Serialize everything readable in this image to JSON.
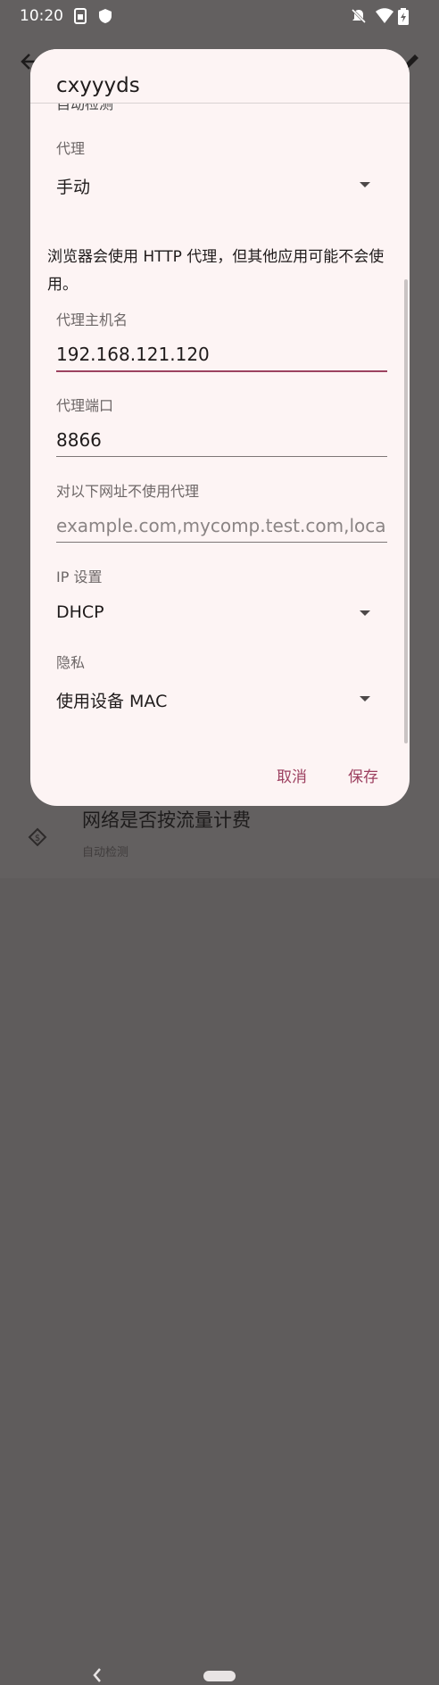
{
  "status_bar": {
    "time": "10:20",
    "icons": [
      "sim-icon",
      "shield-icon",
      "notifications-off-icon",
      "wifi-icon",
      "battery-icon"
    ]
  },
  "background": {
    "row_title": "网络是否按流量计费",
    "row_subtitle": "自动检测"
  },
  "dialog": {
    "title": "cxyyyds",
    "partial_text": "自动检测",
    "proxy": {
      "label": "代理",
      "value": "手动"
    },
    "note": "浏览器会使用 HTTP 代理，但其他应用可能不会使用。",
    "hostname": {
      "label": "代理主机名",
      "value": "192.168.121.120"
    },
    "port": {
      "label": "代理端口",
      "value": "8866"
    },
    "bypass": {
      "label": "对以下网址不使用代理",
      "placeholder": "example.com,mycomp.test.com,localhost"
    },
    "ip_settings": {
      "label": "IP 设置",
      "value": "DHCP"
    },
    "privacy": {
      "label": "隐私",
      "value": "使用设备 MAC"
    },
    "cancel_label": "取消",
    "save_label": "保存"
  },
  "colors": {
    "accent": "#9c4260",
    "dialog_bg": "#fdf4f4",
    "scrim": "#636060"
  }
}
